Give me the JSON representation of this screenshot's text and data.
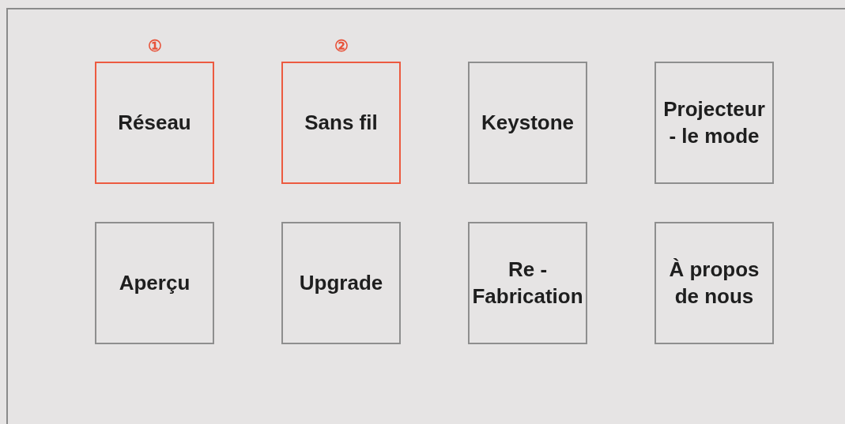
{
  "rows": [
    {
      "tiles": [
        {
          "label": "Réseau",
          "highlighted": true,
          "marker": "①"
        },
        {
          "label": "Sans fil",
          "highlighted": true,
          "marker": "②"
        },
        {
          "label": "Keystone",
          "highlighted": false
        },
        {
          "label": "Projecteur - le mode",
          "highlighted": false
        }
      ]
    },
    {
      "tiles": [
        {
          "label": "Aperçu",
          "highlighted": false
        },
        {
          "label": "Upgrade",
          "highlighted": false
        },
        {
          "label": "Re - Fabrication",
          "highlighted": false
        },
        {
          "label": "À propos de nous",
          "highlighted": false
        }
      ]
    }
  ]
}
